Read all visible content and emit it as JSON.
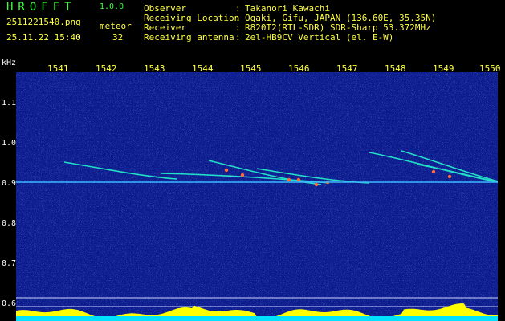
{
  "app": {
    "title": "HROFFT",
    "version": "1.0.0"
  },
  "capture": {
    "filename": "2511221540.png",
    "datetime": "25.11.22 15:40",
    "meteor_label": "meteor",
    "meteor_count": "32"
  },
  "station": {
    "rows": [
      {
        "key": "Observer",
        "sep": ":",
        "value": "Takanori Kawachi"
      },
      {
        "key": "Receiving Location",
        "sep": ":",
        "value": "Ogaki, Gifu, JAPAN (136.60E, 35.35N)"
      },
      {
        "key": "Receiver",
        "sep": ":",
        "value": "R820T2(RTL-SDR) SDR-Sharp 53.372MHz"
      },
      {
        "key": "Receiving antenna",
        "sep": ":",
        "value": "2el-HB9CV Vertical (el. E-W)"
      }
    ]
  },
  "axes": {
    "y_unit": "kHz",
    "y_ticks": [
      "1.1",
      "1.0",
      "0.9",
      "0.8",
      "0.7",
      "0.6"
    ],
    "x_ticks": [
      "1541",
      "1542",
      "1543",
      "1544",
      "1545",
      "1546",
      "1547",
      "1548",
      "1549",
      "1550"
    ]
  },
  "colors": {
    "background": "#0b1a8c",
    "label_yellow": "#ffff40",
    "title_green": "#3cff3c",
    "amplitude_fill": "#ffff00",
    "amplitude_base": "#00e0ff",
    "carrier": "#3cb8ff"
  }
}
